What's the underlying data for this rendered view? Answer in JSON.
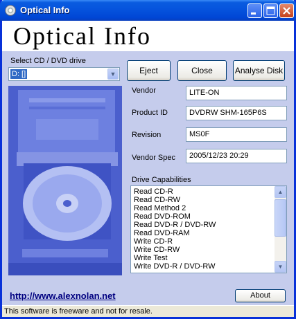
{
  "window": {
    "title": "Optical Info"
  },
  "banner": {
    "title": "Optical Info"
  },
  "drive_select": {
    "label": "Select CD / DVD drive",
    "value": "D: []"
  },
  "buttons": {
    "eject": "Eject",
    "close": "Close",
    "analyse": "Analyse Disk",
    "about": "About"
  },
  "info": {
    "vendor": {
      "label": "Vendor",
      "value": "LITE-ON"
    },
    "product_id": {
      "label": "Product ID",
      "value": "DVDRW SHM-165P6S"
    },
    "revision": {
      "label": "Revision",
      "value": "MS0F"
    },
    "vendor_spec": {
      "label": "Vendor Spec",
      "value": "2005/12/23 20:29"
    }
  },
  "capabilities": {
    "label": "Drive Capabilities",
    "items": [
      "Read CD-R",
      "Read CD-RW",
      "Read Method 2",
      "Read DVD-ROM",
      "Read DVD-R / DVD-RW",
      "Read DVD-RAM",
      "Write CD-R",
      "Write CD-RW",
      "Write Test",
      "Write DVD-R / DVD-RW"
    ]
  },
  "footer": {
    "link": "http://www.alexnolan.net"
  },
  "status": {
    "text": "This software is freeware and not for resale."
  },
  "colors": {
    "titlebar": "#0552dc",
    "panel": "#c5ccec",
    "photo": "#4a5fcf"
  },
  "icons": {
    "app": "cd-disc-icon",
    "minimize": "minimize-icon",
    "maximize": "maximize-icon",
    "close": "close-icon"
  }
}
